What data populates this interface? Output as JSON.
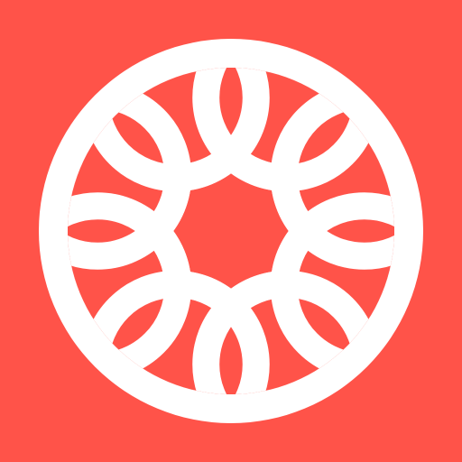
{
  "icon": {
    "name": "Rosette logo",
    "background_color": "#ff5349",
    "mark_color": "#ffffff",
    "petal_count": 8
  }
}
